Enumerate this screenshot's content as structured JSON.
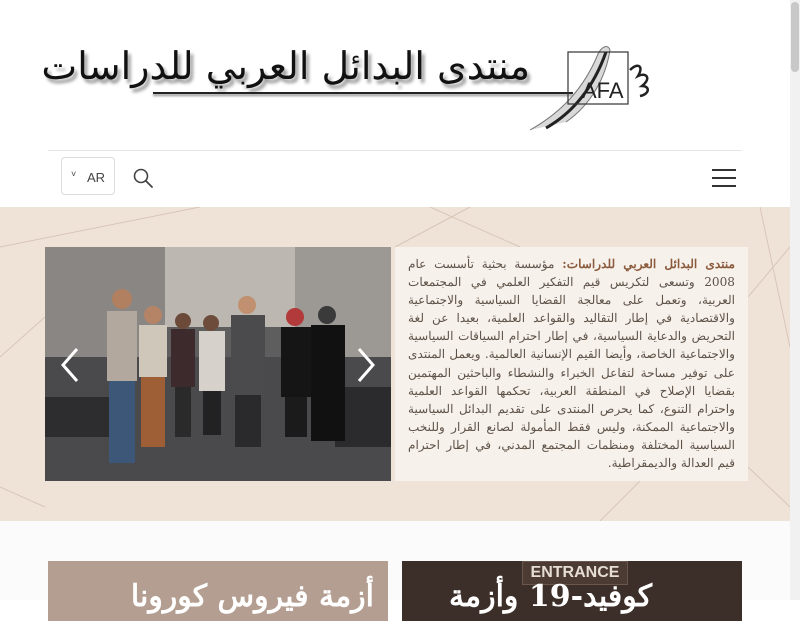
{
  "site": {
    "logo_text": "منتدى البدائل العربي للدراسات",
    "logo_letters": "AFA"
  },
  "header": {
    "language": "AR"
  },
  "intro": {
    "lead": "منتدى البدائل العربي للدراسات:",
    "body": " مؤسسة بحثية تأسست عام 2008 وتسعى لتكريس قيم التفكير العلمي في المجتمعات العربية، وتعمل على معالجة القضايا السياسية والاجتماعية والاقتصادية في إطار التقاليد والقواعد العلمية، بعيدا عن لغة التحريض والدعاية السياسية، في إطار احترام السياقات السياسية والاجتماعية الخاصة، وأيضا القيم الإنسانية العالمية. ويعمل المنتدى على توفير مساحة لتفاعل الخبراء والنشطاء والباحثين المهتمين بقضايا الإصلاح في المنطقة العربية، تحكمها القواعد العلمية واحترام التنوع، كما يحرص المنتدى على تقديم البدائل السياسية والاجتماعية الممكنة، وليس فقط المأمولة لصانع القرار وللنخب السياسية المختلفة ومنظمات المجتمع المدني، في إطار احترام قيم العدالة والديمقراطية."
  },
  "cards": [
    {
      "title": "أزمة فيروس كورونا"
    },
    {
      "title": "كوفيد-19 وأزمة",
      "sign": "ENTRANCE"
    }
  ],
  "colors": {
    "hero_bg": "#efe3d8",
    "intro_bg": "#f7f1eb",
    "lead": "#8a5a3c",
    "text": "#5d5248"
  },
  "icons": {
    "language_chevron": "chevron-down-icon",
    "search": "search-icon",
    "menu": "hamburger-menu-icon",
    "prev": "chevron-left-icon",
    "next": "chevron-right-icon"
  }
}
